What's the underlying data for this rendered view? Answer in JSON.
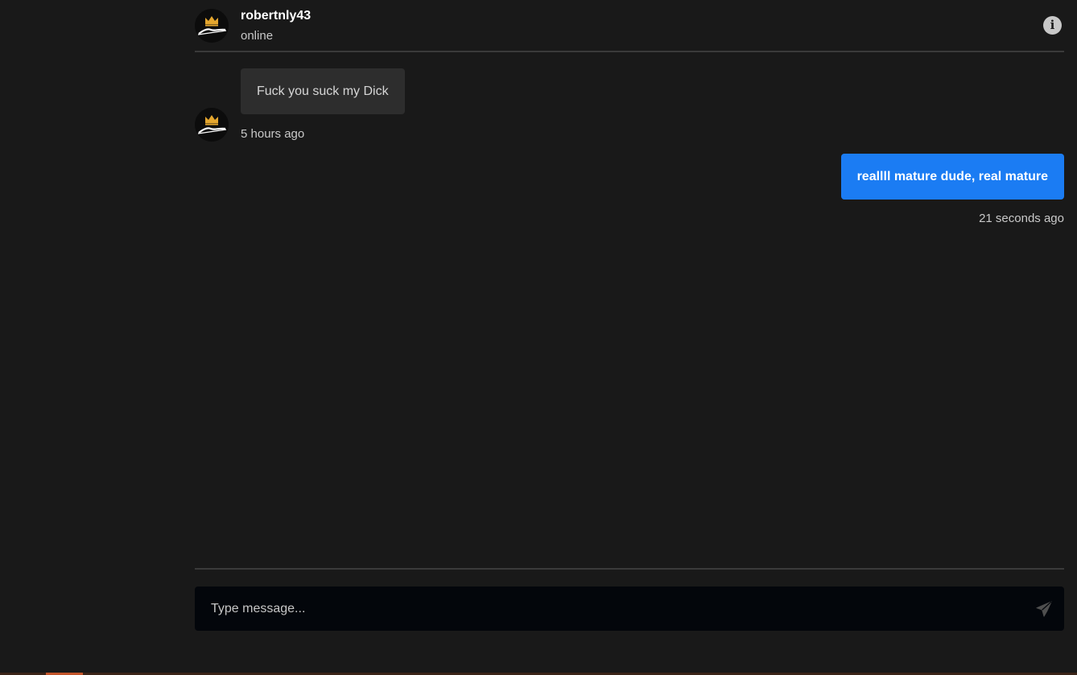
{
  "header": {
    "contact_name": "robertnly43",
    "status": "online",
    "avatar_icon": "modvibe-logo-icon",
    "info_icon": "info-icon"
  },
  "messages": [
    {
      "direction": "incoming",
      "text": "Fuck you suck my Dick",
      "time": "5 hours ago",
      "avatar_icon": "modvibe-logo-icon"
    },
    {
      "direction": "outgoing",
      "text": "reallll mature dude, real mature",
      "time": "21 seconds ago"
    }
  ],
  "composer": {
    "placeholder": "Type message...",
    "value": "",
    "send_icon": "send-icon"
  },
  "colors": {
    "background": "#191919",
    "incoming_bubble": "#2d2d2d",
    "outgoing_bubble": "#1b7cf3",
    "composer_bg": "#03060b",
    "divider": "#3a3a3a"
  }
}
